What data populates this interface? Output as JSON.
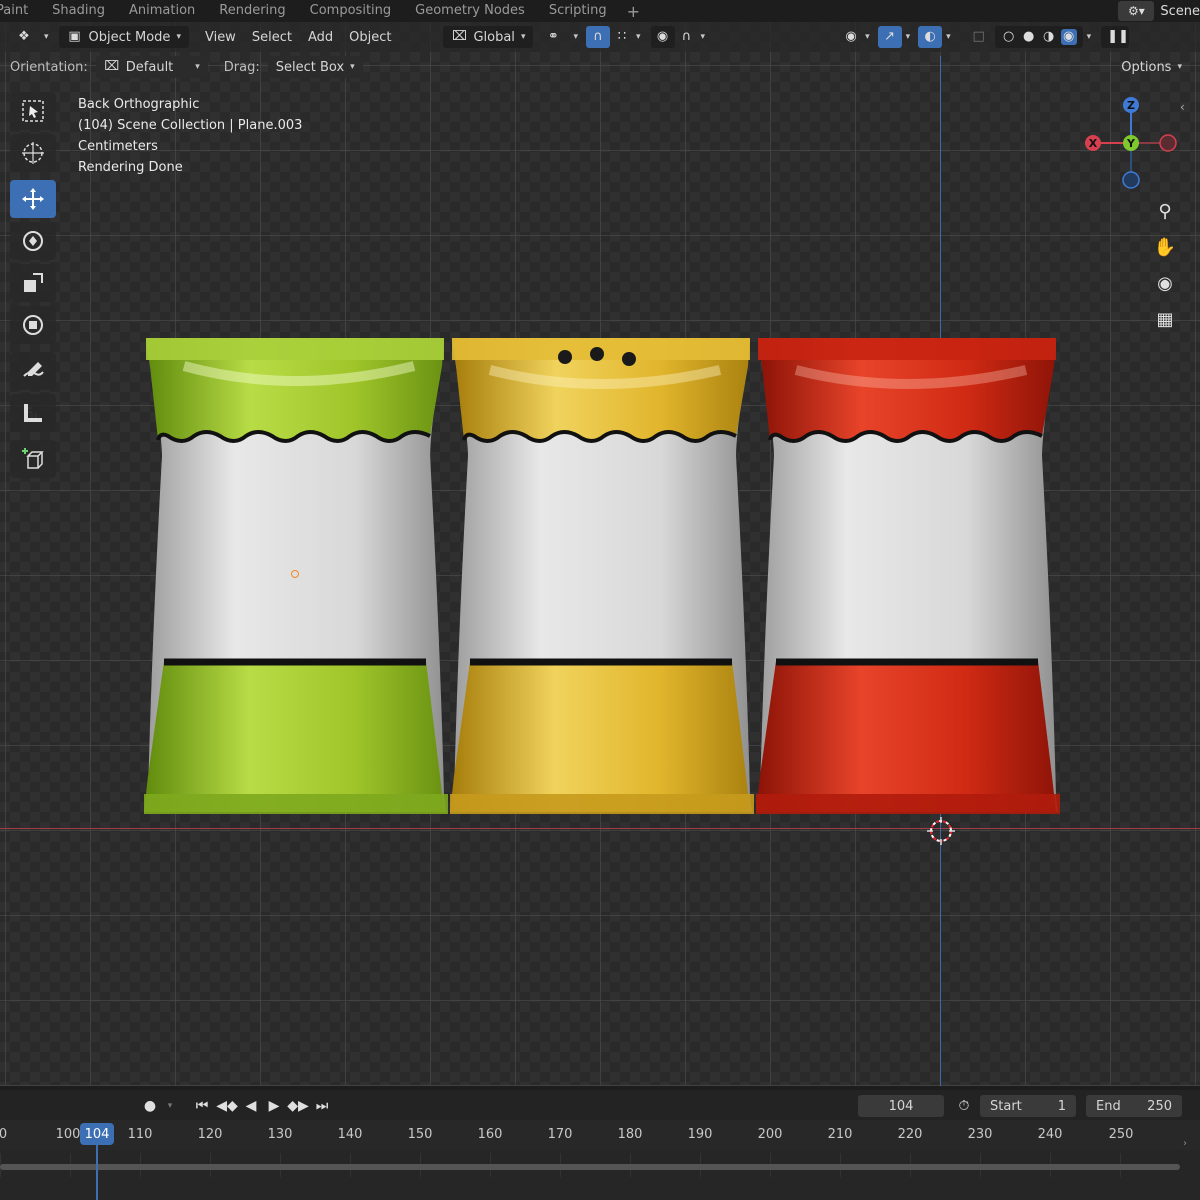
{
  "workspace_tabs": [
    "Paint",
    "Shading",
    "Animation",
    "Rendering",
    "Compositing",
    "Geometry Nodes",
    "Scripting"
  ],
  "add_tab": "+",
  "scene_label": "Scene",
  "header": {
    "mode": "Object Mode",
    "menus": [
      "View",
      "Select",
      "Add",
      "Object"
    ],
    "transform": "Global"
  },
  "row2": {
    "orientation_label": "Orientation:",
    "orientation_value": "Default",
    "drag_label": "Drag:",
    "drag_value": "Select Box",
    "options": "Options"
  },
  "viewport_info": {
    "view": "Back Orthographic",
    "collection": "(104) Scene Collection | Plane.003",
    "units": "Centimeters",
    "status": "Rendering Done"
  },
  "gizmo": {
    "x": "X",
    "y": "Y",
    "z": "Z"
  },
  "bags": [
    {
      "name": "green",
      "color": "#9fc52a",
      "dark": "#6f9416",
      "light": "#d6ec7c"
    },
    {
      "name": "yellow",
      "color": "#e1b52c",
      "dark": "#b58a12",
      "light": "#f2dc7a"
    },
    {
      "name": "red",
      "color": "#d02a14",
      "dark": "#9c1608",
      "light": "#ef6a4a"
    }
  ],
  "timeline": {
    "current_frame": "104",
    "start_label": "Start",
    "start_value": "1",
    "end_label": "End",
    "end_value": "250",
    "ruler": [
      "0",
      "100",
      "110",
      "120",
      "130",
      "140",
      "150",
      "160",
      "170",
      "180",
      "190",
      "200",
      "210",
      "220",
      "230",
      "240",
      "250"
    ],
    "marker": "104"
  }
}
